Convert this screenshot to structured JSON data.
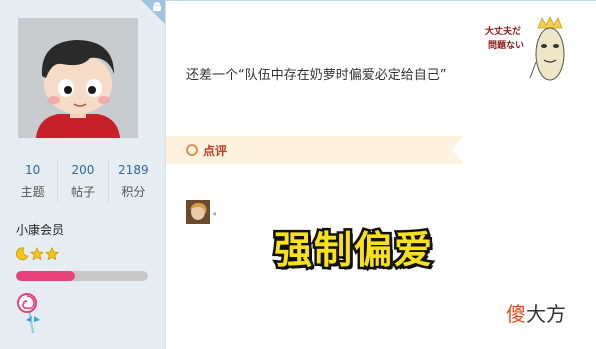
{
  "profile": {
    "stats": [
      {
        "value": "10",
        "label": "主题"
      },
      {
        "value": "200",
        "label": "帖子"
      },
      {
        "value": "2189",
        "label": "积分"
      }
    ],
    "group": "小康会员",
    "rank_progress": 0.45,
    "icons": {
      "platform": "android-icon",
      "medal": "lollipop-medal-icon"
    }
  },
  "post": {
    "message": "还差一个“队伍中存在奶萝时偏爱必定给自己”",
    "sticker_text": "大丈夫だ 問題ない",
    "review_label": "点评",
    "caption": "强制偏爱",
    "watermark_a": "傻",
    "watermark_b": "大方"
  },
  "colors": {
    "panel": "#e5edf2",
    "review_bar": "#fcf2dd",
    "review_text": "#c0392b",
    "caption": "#f7e01d",
    "rank_fill": "#e8427a"
  }
}
